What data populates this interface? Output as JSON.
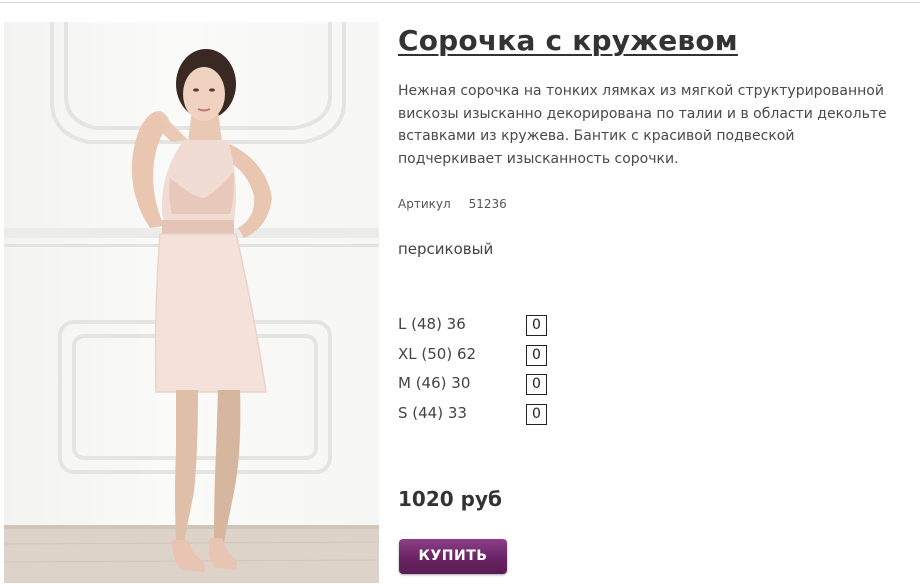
{
  "product": {
    "title": "Сорочка с кружевом",
    "description": "Нежная сорочка на тонких лямках из мягкой структурированной вискозы изысканно декорирована по талии и в области декольте вставками из кружева. Бантик с красивой подвеской подчеркивает изысканность сорочки.",
    "sku_label": "Артикул",
    "sku_value": "51236",
    "color": "персиковый",
    "sizes": [
      {
        "label": "L (48)   36",
        "qty": "0"
      },
      {
        "label": "XL (50)   62",
        "qty": "0"
      },
      {
        "label": "M (46)   30",
        "qty": "0"
      },
      {
        "label": "S (44)   33",
        "qty": "0"
      }
    ],
    "price": "1020 руб",
    "buy_label": "КУПИТЬ"
  },
  "colors": {
    "buy_button": "#6a2464",
    "text": "#333333"
  },
  "icons": {
    "photo": "product-photo"
  }
}
